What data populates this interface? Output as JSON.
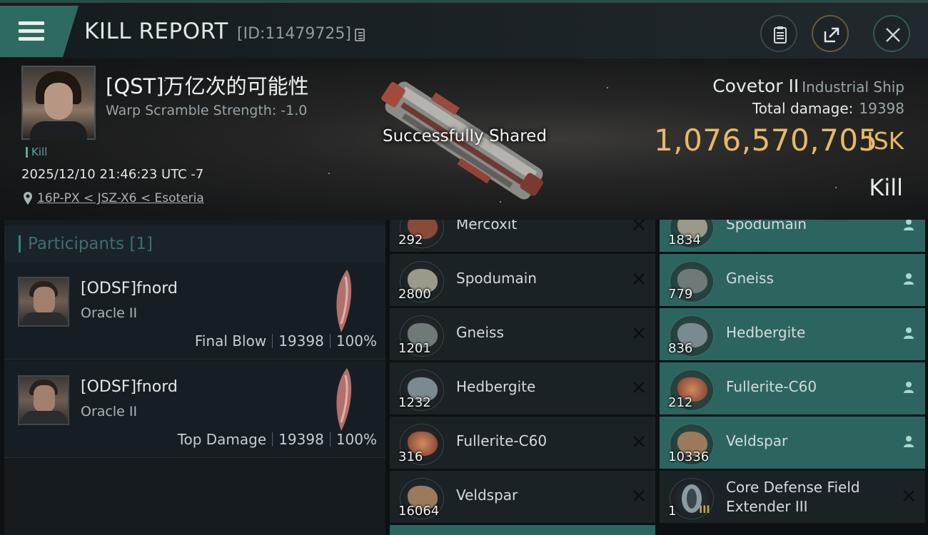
{
  "header": {
    "title": "KILL REPORT",
    "report_id": "[ID:11479725]"
  },
  "victim": {
    "name": "[QST]万亿次的可能性",
    "warp_scramble": "Warp Scramble Strength: -1.0",
    "tag": "Kill",
    "datetime": "2025/12/10 21:46:23 UTC -7",
    "location": "16P-PX < JSZ-X6 < Esoteria"
  },
  "toast": "Successfully Shared",
  "summary": {
    "ship_name": "Covetor II",
    "ship_class": "Industrial Ship",
    "total_damage_label": "Total damage:",
    "total_damage": "19398",
    "isk_value": "1,076,570,705",
    "isk_unit": "ISK",
    "result": "Kill"
  },
  "participants": {
    "header": "Participants [1]",
    "rows": [
      {
        "name": "[ODSF]fnord",
        "ship": "Oracle II",
        "role": "Final Blow",
        "damage": "19398",
        "percent": "100%"
      },
      {
        "name": "[ODSF]fnord",
        "ship": "Oracle II",
        "role": "Top Damage",
        "damage": "19398",
        "percent": "100%"
      }
    ]
  },
  "items": {
    "destroyed": [
      {
        "name": "Mercoxit",
        "qty": "292",
        "color": "#8a4a3a"
      },
      {
        "name": "Spodumain",
        "qty": "2800",
        "color": "#9a9a88"
      },
      {
        "name": "Gneiss",
        "qty": "1201",
        "color": "#6f7a78"
      },
      {
        "name": "Hedbergite",
        "qty": "1232",
        "color": "#7a8a90"
      },
      {
        "name": "Fullerite-C60",
        "qty": "316",
        "color": "#b0704a"
      },
      {
        "name": "Veldspar",
        "qty": "16064",
        "color": "#9a7a5a"
      }
    ],
    "dropped": [
      {
        "name": "Spodumain",
        "qty": "1834",
        "color": "#9a9a88"
      },
      {
        "name": "Gneiss",
        "qty": "779",
        "color": "#6f7a78"
      },
      {
        "name": "Hedbergite",
        "qty": "836",
        "color": "#7a8a90"
      },
      {
        "name": "Fullerite-C60",
        "qty": "212",
        "color": "#b0704a"
      },
      {
        "name": "Veldspar",
        "qty": "10336",
        "color": "#9a7a5a"
      }
    ],
    "module": {
      "name": "Core Defense Field Extender III",
      "qty": "1",
      "meta": "III"
    }
  },
  "colors": {
    "accent": "#2f6a62",
    "isk": "#e8b865",
    "dropped_bg": "#2c6560"
  }
}
